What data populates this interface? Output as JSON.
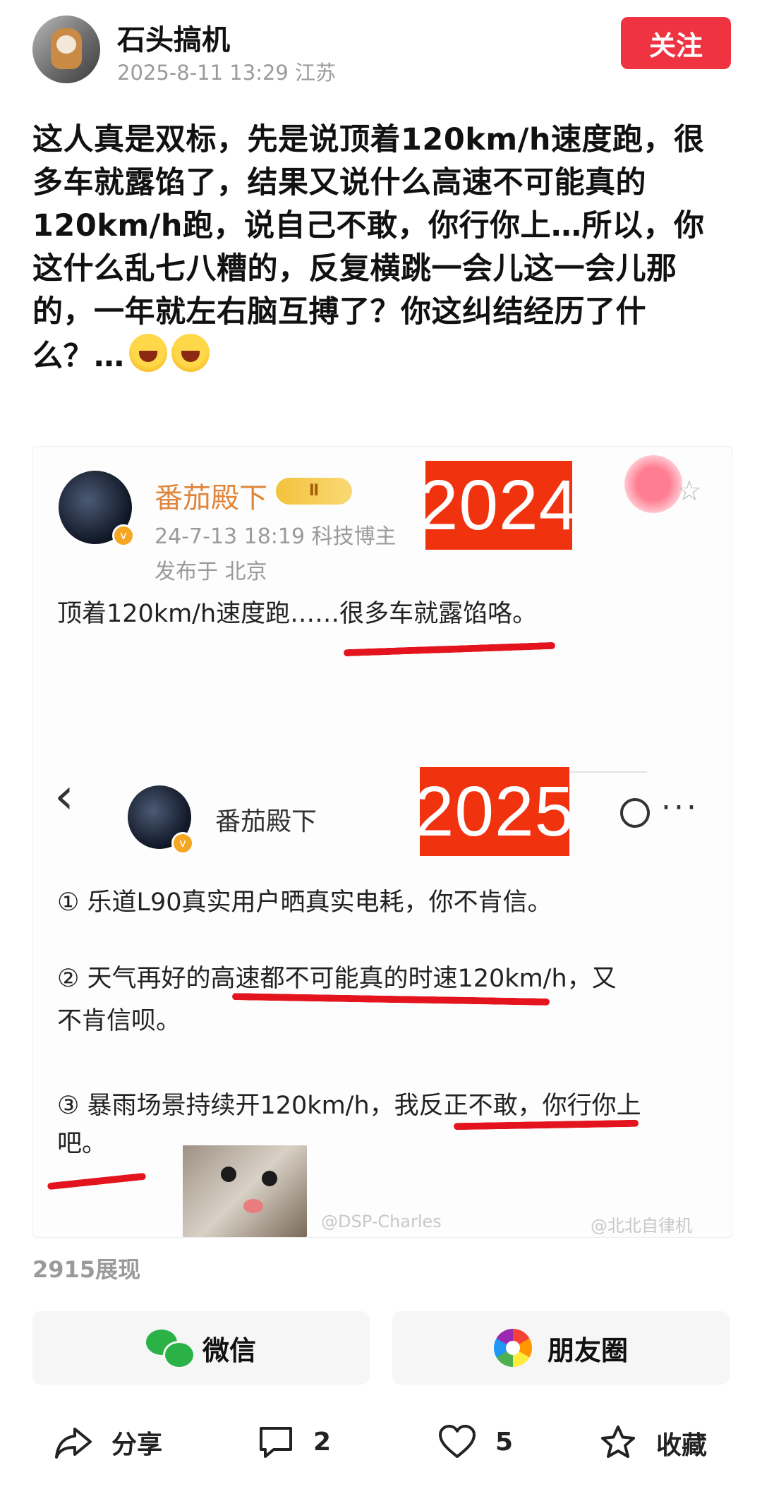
{
  "header": {
    "username": "石头搞机",
    "meta": "2025-8-11 13:29 江苏",
    "follow_label": "关注"
  },
  "post": {
    "text": "这人真是双标，先是说顶着120km/h速度跑，很多车就露馅了，结果又说什么高速不可能真的120km/h跑，说自己不敢，你行你上…所以，你这什么乱七八糟的，反复横跳一会儿这一会儿那的，一年就左右脑互搏了？你这纠结经历了什么？…"
  },
  "embed": {
    "top": {
      "name": "番茄殿下",
      "level": "Ⅱ",
      "meta": "24-7-13 18:19  科技博主",
      "location": "发布于 北京",
      "year_tag": "2024",
      "content": "顶着120km/h速度跑……很多车就露馅咯。"
    },
    "bottom": {
      "back_icon": "‹",
      "name": "番茄殿下",
      "year_tag": "2025",
      "more": "···",
      "item1": "① 乐道L90真实用户晒真实电耗，你不肯信。",
      "item2a": "② 天气再好的高速都不可能真的时速120km/h，又",
      "item2b": "不肯信呗。",
      "item3a": "③ 暴雨场景持续开120km/h，我反正不敢，你行你上",
      "item3b": "吧。",
      "watermark1": "@DSP-Charles",
      "watermark2": "@北北自律机"
    }
  },
  "views": "2915展现",
  "share": {
    "wechat": "微信",
    "moments": "朋友圈"
  },
  "bottom_bar": {
    "share": "分享",
    "comments": "2",
    "likes": "5",
    "favorite": "收藏"
  },
  "colors": {
    "accent_red": "#ef3340",
    "underline_red": "#e3141e",
    "year_tag_red": "#f0320f",
    "wechat_green": "#2ab247"
  }
}
